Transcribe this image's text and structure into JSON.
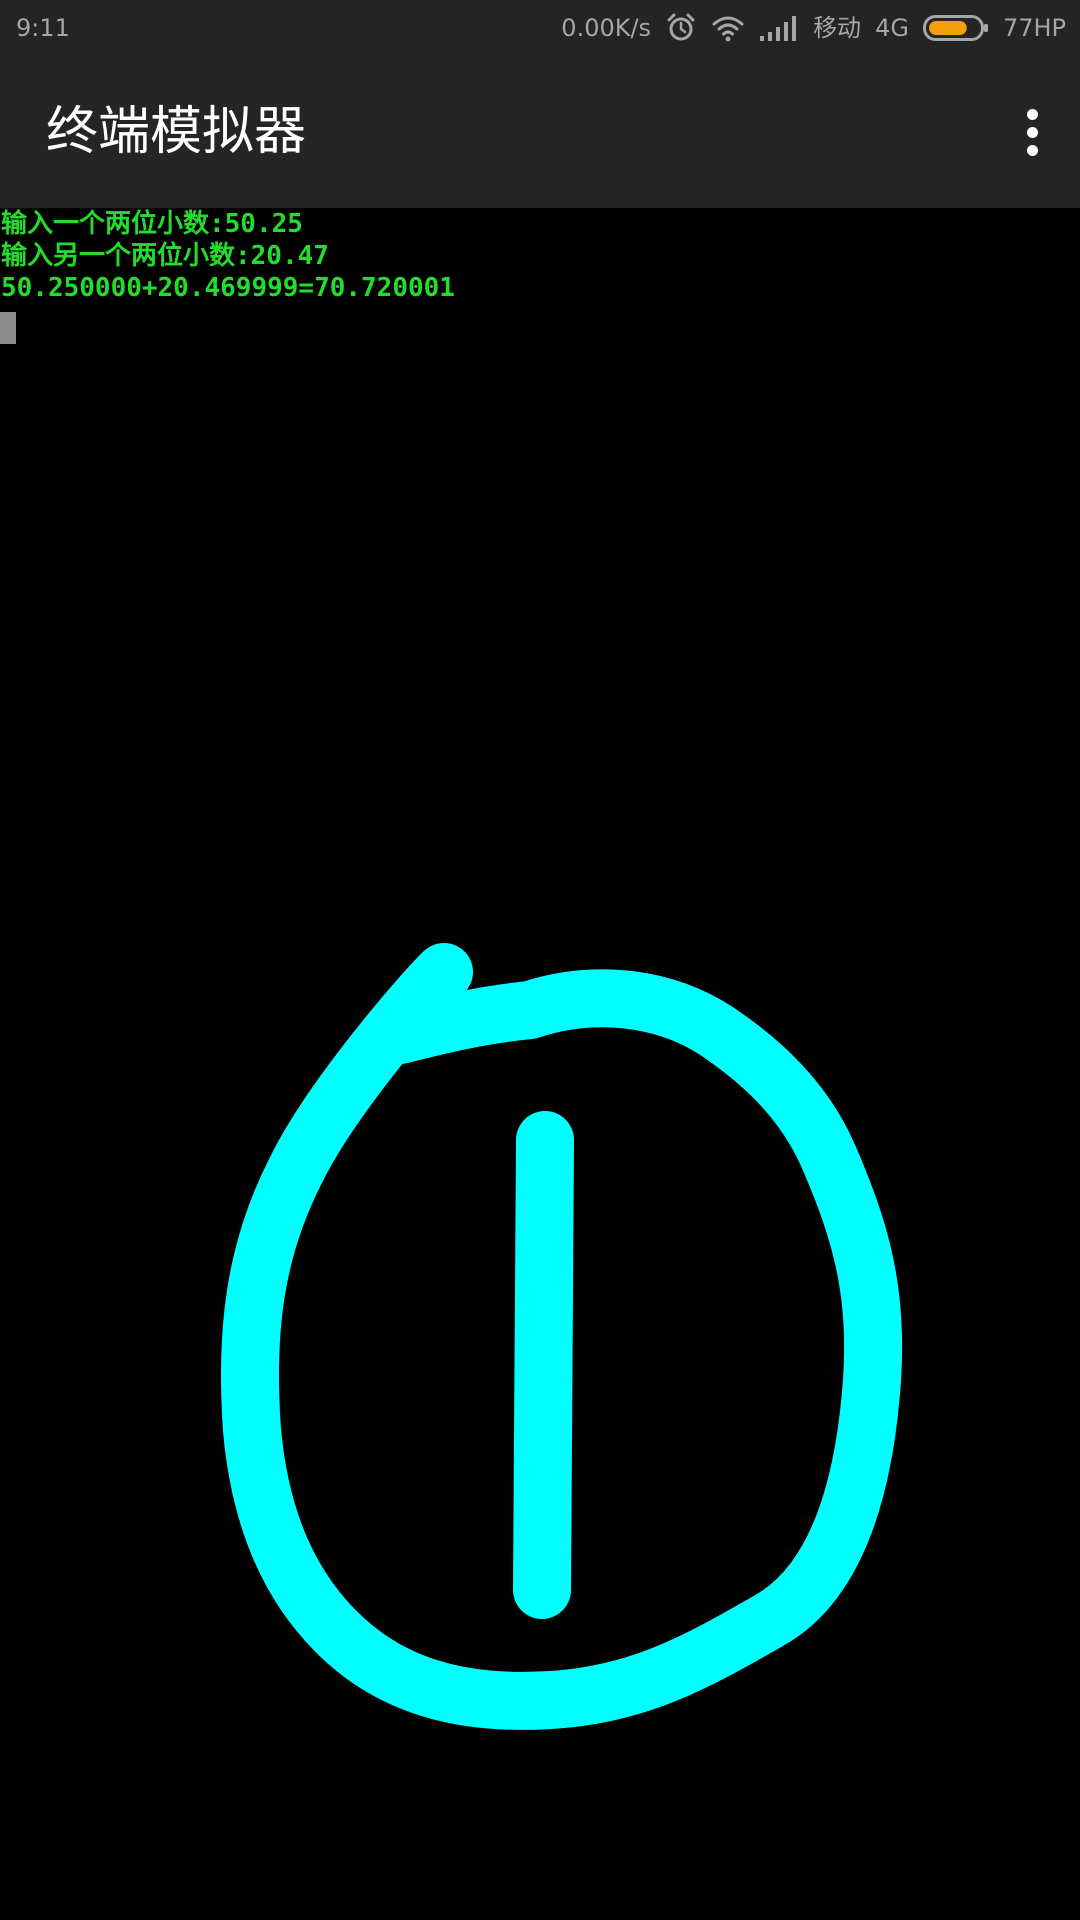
{
  "status_bar": {
    "time": "9:11",
    "net_speed": "0.00K/s",
    "carrier": "移动",
    "network_type": "4G",
    "battery_label": "77HP",
    "battery_level_percent": 77,
    "icons": [
      "alarm-icon",
      "wifi-icon",
      "signal-icon",
      "battery-icon"
    ],
    "battery_color": "#f5a00f"
  },
  "app_bar": {
    "title": "终端模拟器",
    "menu_icon": "overflow-menu-icon"
  },
  "terminal": {
    "text_color": "#22dd2a",
    "lines": [
      "输入一个两位小数:50.25",
      "输入另一个两位小数:20.47",
      "50.250000+20.469999=70.720001"
    ]
  },
  "drawing": {
    "stroke_color": "#00ffff"
  }
}
